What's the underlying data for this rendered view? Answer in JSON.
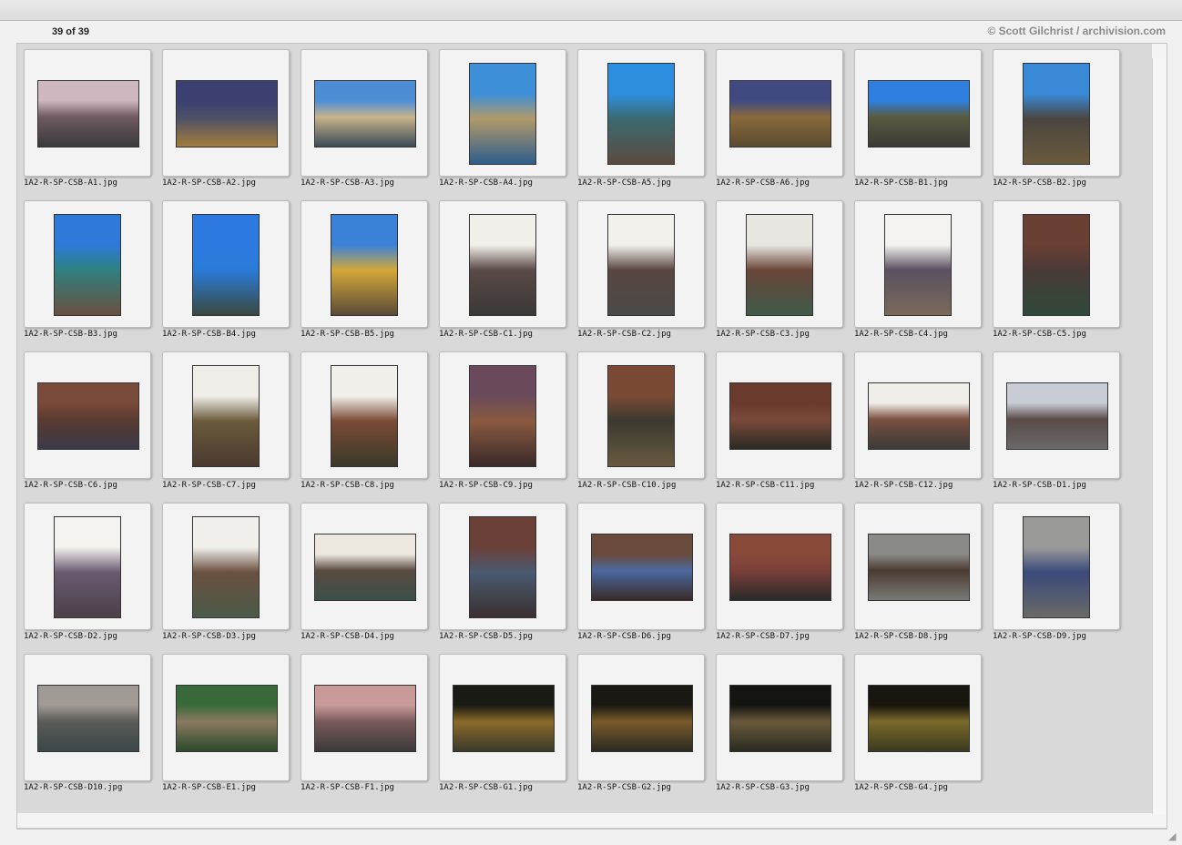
{
  "header": {
    "count": "39 of 39",
    "credit": "© Scott Gilchrist / archivision.com"
  },
  "images": [
    {
      "name": "1A2-R-SP-CSB-A1.jpg",
      "orientation": "landscape",
      "colors": [
        "#cfb7c0",
        "#6e5a60",
        "#3b3a3c"
      ]
    },
    {
      "name": "1A2-R-SP-CSB-A2.jpg",
      "orientation": "landscape",
      "colors": [
        "#3b4070",
        "#4b4f6a",
        "#a27d3c"
      ]
    },
    {
      "name": "1A2-R-SP-CSB-A3.jpg",
      "orientation": "landscape",
      "colors": [
        "#4c8dd6",
        "#c8b48c",
        "#3a4a55"
      ]
    },
    {
      "name": "1A2-R-SP-CSB-A4.jpg",
      "orientation": "portrait",
      "colors": [
        "#3d8fd8",
        "#b09a68",
        "#2f5d8c"
      ]
    },
    {
      "name": "1A2-R-SP-CSB-A5.jpg",
      "orientation": "portrait",
      "colors": [
        "#2e8fe0",
        "#3a6a70",
        "#5b4a40"
      ]
    },
    {
      "name": "1A2-R-SP-CSB-A6.jpg",
      "orientation": "landscape",
      "colors": [
        "#404a80",
        "#8a6a3c",
        "#5a4b30"
      ]
    },
    {
      "name": "1A2-R-SP-CSB-B1.jpg",
      "orientation": "landscape",
      "colors": [
        "#2f7fe0",
        "#5a5a40",
        "#3d3a35"
      ]
    },
    {
      "name": "1A2-R-SP-CSB-B2.jpg",
      "orientation": "portrait",
      "colors": [
        "#3b8ad8",
        "#4a4540",
        "#6a5a3c"
      ]
    },
    {
      "name": "1A2-R-SP-CSB-B3.jpg",
      "orientation": "portrait",
      "colors": [
        "#2d7ad8",
        "#2f8080",
        "#6a5040"
      ]
    },
    {
      "name": "1A2-R-SP-CSB-B4.jpg",
      "orientation": "portrait",
      "colors": [
        "#2c7ae0",
        "#2a7bd8",
        "#3a4a40"
      ]
    },
    {
      "name": "1A2-R-SP-CSB-B5.jpg",
      "orientation": "portrait",
      "colors": [
        "#3a82d8",
        "#d4a83a",
        "#5a4a38"
      ]
    },
    {
      "name": "1A2-R-SP-CSB-C1.jpg",
      "orientation": "portrait",
      "colors": [
        "#f2f0ea",
        "#5a4a48",
        "#3a3838"
      ]
    },
    {
      "name": "1A2-R-SP-CSB-C2.jpg",
      "orientation": "portrait",
      "colors": [
        "#f3f1ec",
        "#5a4640",
        "#4a4a48"
      ]
    },
    {
      "name": "1A2-R-SP-CSB-C3.jpg",
      "orientation": "portrait",
      "colors": [
        "#e8e6e0",
        "#6a4638",
        "#3f5a4a"
      ]
    },
    {
      "name": "1A2-R-SP-CSB-C4.jpg",
      "orientation": "portrait",
      "colors": [
        "#f4f3ef",
        "#5a5060",
        "#7a6a5a"
      ]
    },
    {
      "name": "1A2-R-SP-CSB-C5.jpg",
      "orientation": "portrait",
      "colors": [
        "#6a3f34",
        "#4a3a36",
        "#2f4a3a"
      ]
    },
    {
      "name": "1A2-R-SP-CSB-C6.jpg",
      "orientation": "landscape",
      "colors": [
        "#7a4a3a",
        "#5a3a30",
        "#3a3a48"
      ]
    },
    {
      "name": "1A2-R-SP-CSB-C7.jpg",
      "orientation": "portrait",
      "colors": [
        "#f0eee8",
        "#6a5a3a",
        "#4a3a30"
      ]
    },
    {
      "name": "1A2-R-SP-CSB-C8.jpg",
      "orientation": "portrait",
      "colors": [
        "#f2f0ea",
        "#7a4a34",
        "#3a3a2a"
      ]
    },
    {
      "name": "1A2-R-SP-CSB-C9.jpg",
      "orientation": "portrait",
      "colors": [
        "#6a4a5a",
        "#8a5a40",
        "#3a2a2a"
      ]
    },
    {
      "name": "1A2-R-SP-CSB-C10.jpg",
      "orientation": "portrait",
      "colors": [
        "#7a4a34",
        "#3a3a30",
        "#6a5a40"
      ]
    },
    {
      "name": "1A2-R-SP-CSB-C11.jpg",
      "orientation": "landscape",
      "colors": [
        "#6a3a2c",
        "#7a4a3a",
        "#2a2a22"
      ]
    },
    {
      "name": "1A2-R-SP-CSB-C12.jpg",
      "orientation": "landscape",
      "colors": [
        "#f0eee8",
        "#7a5040",
        "#3a3a38"
      ]
    },
    {
      "name": "1A2-R-SP-CSB-D1.jpg",
      "orientation": "landscape",
      "colors": [
        "#c8ccd4",
        "#5a4a48",
        "#6a6a6a"
      ]
    },
    {
      "name": "1A2-R-SP-CSB-D2.jpg",
      "orientation": "portrait",
      "colors": [
        "#f4f3f0",
        "#6a5a70",
        "#4a4048"
      ]
    },
    {
      "name": "1A2-R-SP-CSB-D3.jpg",
      "orientation": "portrait",
      "colors": [
        "#f2f0ec",
        "#6a5040",
        "#4a5a48"
      ]
    },
    {
      "name": "1A2-R-SP-CSB-D4.jpg",
      "orientation": "landscape",
      "colors": [
        "#ece8e0",
        "#5a4a40",
        "#3a5048"
      ]
    },
    {
      "name": "1A2-R-SP-CSB-D5.jpg",
      "orientation": "portrait",
      "colors": [
        "#6a4038",
        "#4a5a70",
        "#3a3030"
      ]
    },
    {
      "name": "1A2-R-SP-CSB-D6.jpg",
      "orientation": "landscape",
      "colors": [
        "#6a4a3a",
        "#4a6aa0",
        "#3a2a28"
      ]
    },
    {
      "name": "1A2-R-SP-CSB-D7.jpg",
      "orientation": "landscape",
      "colors": [
        "#8a4a3a",
        "#7a4038",
        "#2a2a2a"
      ]
    },
    {
      "name": "1A2-R-SP-CSB-D8.jpg",
      "orientation": "landscape",
      "colors": [
        "#8a8a88",
        "#4a3a30",
        "#7a7a78"
      ]
    },
    {
      "name": "1A2-R-SP-CSB-D9.jpg",
      "orientation": "portrait",
      "colors": [
        "#9a9a98",
        "#3a4a7a",
        "#6a6a68"
      ]
    },
    {
      "name": "1A2-R-SP-CSB-D10.jpg",
      "orientation": "landscape",
      "colors": [
        "#a09a94",
        "#5a5a58",
        "#3a4848"
      ]
    },
    {
      "name": "1A2-R-SP-CSB-E1.jpg",
      "orientation": "landscape",
      "colors": [
        "#3a6a3a",
        "#8a7a60",
        "#2a4a2a"
      ]
    },
    {
      "name": "1A2-R-SP-CSB-F1.jpg",
      "orientation": "landscape",
      "colors": [
        "#c89a9a",
        "#7a5a5a",
        "#3a3a3a"
      ]
    },
    {
      "name": "1A2-R-SP-CSB-G1.jpg",
      "orientation": "landscape",
      "colors": [
        "#1a1a14",
        "#8a6a2a",
        "#3a3a2a"
      ]
    },
    {
      "name": "1A2-R-SP-CSB-G2.jpg",
      "orientation": "landscape",
      "colors": [
        "#1a1812",
        "#7a5a2a",
        "#2a2a22"
      ]
    },
    {
      "name": "1A2-R-SP-CSB-G3.jpg",
      "orientation": "landscape",
      "colors": [
        "#141410",
        "#6a5a3a",
        "#2a2a20"
      ]
    },
    {
      "name": "1A2-R-SP-CSB-G4.jpg",
      "orientation": "landscape",
      "colors": [
        "#18160f",
        "#7a6a2a",
        "#3a3a1f"
      ]
    }
  ]
}
